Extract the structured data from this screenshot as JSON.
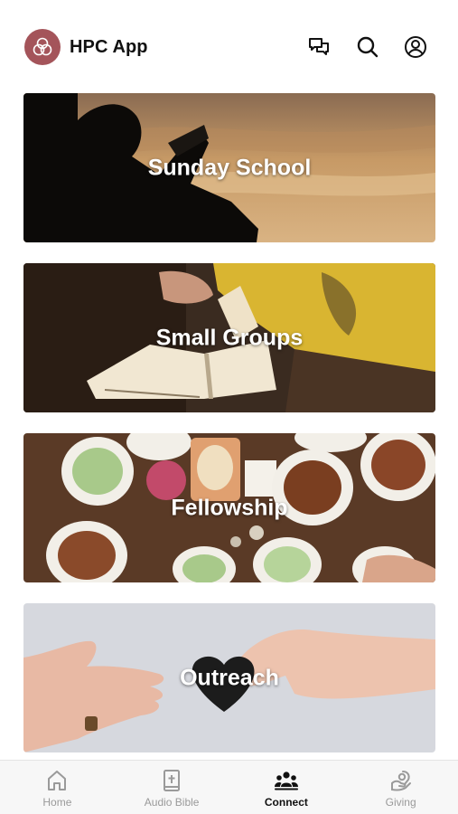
{
  "header": {
    "title": "HPC App",
    "logo_icon": "trinity-knot-icon",
    "logo_color": "#a4545a",
    "icons": [
      "messages-icon",
      "search-icon",
      "profile-icon"
    ]
  },
  "cards": [
    {
      "label": "Sunday School"
    },
    {
      "label": "Small Groups"
    },
    {
      "label": "Fellowship"
    },
    {
      "label": "Outreach"
    }
  ],
  "tabs": [
    {
      "label": "Home",
      "icon": "home-icon",
      "active": false
    },
    {
      "label": "Audio Bible",
      "icon": "bible-icon",
      "active": false
    },
    {
      "label": "Connect",
      "icon": "people-icon",
      "active": true
    },
    {
      "label": "Giving",
      "icon": "giving-icon",
      "active": false
    }
  ],
  "colors": {
    "active_tab": "#111111",
    "inactive_tab": "#9a9a9a"
  }
}
